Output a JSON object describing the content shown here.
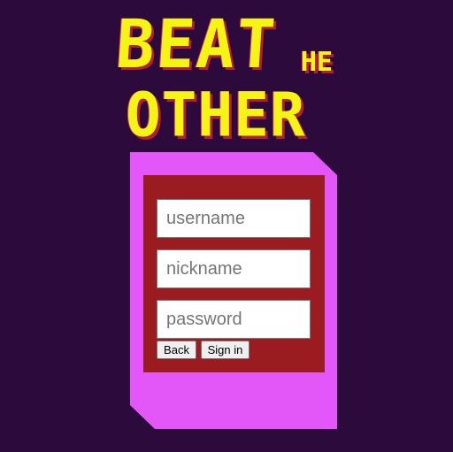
{
  "logo": {
    "word_beat": "BEAT",
    "word_the": "HE",
    "word_other": "OTHER"
  },
  "form": {
    "username": {
      "placeholder": "username",
      "value": ""
    },
    "nickname": {
      "placeholder": "nickname",
      "value": ""
    },
    "password": {
      "placeholder": "password",
      "value": ""
    },
    "back_label": "Back",
    "signin_label": "Sign in"
  },
  "colors": {
    "background": "#2d0a3c",
    "card": "#e356f7",
    "panel": "#9a1c20",
    "logo_text": "#f5f514",
    "logo_shadow": "#b01e3a"
  }
}
